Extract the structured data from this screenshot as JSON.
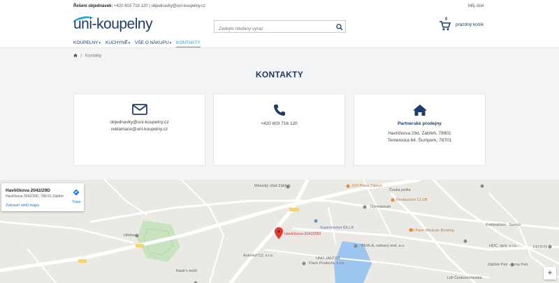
{
  "topbar": {
    "contact_label": "Řešení objednávek:",
    "contact_info": "+420 603 716 120 | objednavky@uni-koupelny.cz",
    "account": "Můj účet"
  },
  "header": {
    "logo": "uni-koupelny",
    "search_placeholder": "Zadejte hledaný výraz",
    "cart_count": "0",
    "cart_label": "prázdný košík"
  },
  "nav": {
    "items": [
      "KOUPELNY",
      "KUCHYNĚ",
      "VŠE O NÁKUPU",
      "KONTAKTY"
    ]
  },
  "breadcrumb": {
    "separator": "/",
    "current": "Kontakty"
  },
  "page_title": "KONTAKTY",
  "cards": {
    "email": {
      "line1": "objednavky@uni-koupelny.cz",
      "line2": "reklamace@uni-koupelny.cz"
    },
    "phone": {
      "line1": "+420 603 716 120"
    },
    "stores": {
      "heading": "Partnerské prodejny",
      "line1": "Havlíčkova 29d, Zábřeh, 78901",
      "line2": "Temenická 64, Šumperk, 78701"
    }
  },
  "map": {
    "infobox": {
      "title": "Havlíčkova 2042/29D",
      "address": "Havlíčkova 2042/29D, 789 01 Zábřeh",
      "link": "Zobrazit větší mapu",
      "route": "Trasa"
    },
    "labels": {
      "pin": "Havlíčkova 2042/29D",
      "museum": "Městský úřad Zábřeh",
      "pizza": "JVS Pizza Zábřeh",
      "post": "Česká pošta",
      "restaurace": "Restaurace CLUB",
      "gymnazium": "Gymnázium",
      "billa": "Supermarket BILLA",
      "bowling": "El Paso Mexican Bowling",
      "kvetiny": "Květinářství - Sanvis",
      "hdc": "HDC, spol. s r.o.",
      "hrbitov": "Hřbitov",
      "perla": "PERLA, nelkaný text, a.s.",
      "uno": "UNO JANTAR",
      "flack": "Flack Products, s.r.o.",
      "autoho": "AutoHof CZ, s.r.o.",
      "rastr": "Rastr's textil",
      "zabrek": "Zábřek Petr - firma Petr",
      "lidl": "Lidl Českomoravská",
      "fkoff": "FKOFIN"
    },
    "zoom_in": "+"
  },
  "colors": {
    "brand": "#1d3c6c",
    "accent": "#2aa3dd"
  }
}
